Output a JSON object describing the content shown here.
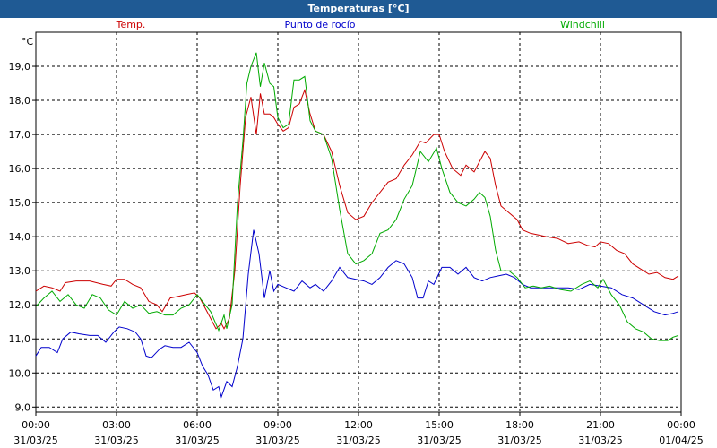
{
  "window": {
    "title": "Temperaturas [°C]"
  },
  "chart_data": {
    "type": "line",
    "title": "Temperaturas [°C]",
    "ylabel": "°C",
    "xlabel": "",
    "ylim": [
      8.85,
      20.0
    ],
    "xlim": [
      0,
      24
    ],
    "grid": true,
    "legend_placement": "top",
    "y_ticks": [
      "9,0",
      "10,0",
      "11,0",
      "12,0",
      "13,0",
      "14,0",
      "15,0",
      "16,0",
      "17,0",
      "18,0",
      "19,0"
    ],
    "y_tick_values": [
      9,
      10,
      11,
      12,
      13,
      14,
      15,
      16,
      17,
      18,
      19
    ],
    "x_ticks": [
      {
        "value": 0,
        "time": "00:00",
        "date": "31/03/25"
      },
      {
        "value": 3,
        "time": "03:00",
        "date": "31/03/25"
      },
      {
        "value": 6,
        "time": "06:00",
        "date": "31/03/25"
      },
      {
        "value": 9,
        "time": "09:00",
        "date": "31/03/25"
      },
      {
        "value": 12,
        "time": "12:00",
        "date": "31/03/25"
      },
      {
        "value": 15,
        "time": "15:00",
        "date": "31/03/25"
      },
      {
        "value": 18,
        "time": "18:00",
        "date": "31/03/25"
      },
      {
        "value": 21,
        "time": "21:00",
        "date": "31/03/25"
      },
      {
        "value": 24,
        "time": "00:00",
        "date": "01/04/25"
      }
    ],
    "series": [
      {
        "name": "Temp.",
        "color": "#cc0000",
        "points": [
          [
            0,
            12.4
          ],
          [
            0.3,
            12.55
          ],
          [
            0.6,
            12.5
          ],
          [
            0.9,
            12.4
          ],
          [
            1.1,
            12.65
          ],
          [
            1.5,
            12.7
          ],
          [
            2.0,
            12.7
          ],
          [
            2.5,
            12.6
          ],
          [
            2.8,
            12.55
          ],
          [
            3.0,
            12.75
          ],
          [
            3.3,
            12.75
          ],
          [
            3.6,
            12.6
          ],
          [
            3.9,
            12.5
          ],
          [
            4.2,
            12.1
          ],
          [
            4.5,
            12.0
          ],
          [
            4.7,
            11.8
          ],
          [
            5.0,
            12.2
          ],
          [
            5.3,
            12.25
          ],
          [
            5.6,
            12.3
          ],
          [
            5.9,
            12.35
          ],
          [
            6.1,
            12.2
          ],
          [
            6.3,
            11.9
          ],
          [
            6.5,
            11.6
          ],
          [
            6.7,
            11.3
          ],
          [
            6.9,
            11.45
          ],
          [
            7.0,
            11.3
          ],
          [
            7.2,
            11.6
          ],
          [
            7.4,
            13.0
          ],
          [
            7.6,
            15.5
          ],
          [
            7.8,
            17.5
          ],
          [
            8.0,
            18.1
          ],
          [
            8.2,
            17.0
          ],
          [
            8.35,
            18.2
          ],
          [
            8.5,
            17.6
          ],
          [
            8.7,
            17.6
          ],
          [
            8.85,
            17.5
          ],
          [
            9.0,
            17.3
          ],
          [
            9.2,
            17.1
          ],
          [
            9.4,
            17.2
          ],
          [
            9.6,
            17.8
          ],
          [
            9.8,
            17.9
          ],
          [
            10.0,
            18.3
          ],
          [
            10.2,
            17.6
          ],
          [
            10.4,
            17.1
          ],
          [
            10.7,
            17.0
          ],
          [
            11.0,
            16.5
          ],
          [
            11.3,
            15.5
          ],
          [
            11.6,
            14.7
          ],
          [
            11.9,
            14.5
          ],
          [
            12.2,
            14.6
          ],
          [
            12.5,
            15.0
          ],
          [
            12.8,
            15.3
          ],
          [
            13.1,
            15.6
          ],
          [
            13.4,
            15.7
          ],
          [
            13.7,
            16.1
          ],
          [
            14.0,
            16.4
          ],
          [
            14.3,
            16.8
          ],
          [
            14.5,
            16.75
          ],
          [
            14.8,
            17.0
          ],
          [
            15.0,
            17.0
          ],
          [
            15.2,
            16.5
          ],
          [
            15.5,
            16.0
          ],
          [
            15.8,
            15.8
          ],
          [
            16.0,
            16.1
          ],
          [
            16.3,
            15.9
          ],
          [
            16.5,
            16.2
          ],
          [
            16.7,
            16.5
          ],
          [
            16.9,
            16.3
          ],
          [
            17.1,
            15.5
          ],
          [
            17.3,
            14.9
          ],
          [
            17.6,
            14.7
          ],
          [
            17.9,
            14.5
          ],
          [
            18.1,
            14.2
          ],
          [
            18.4,
            14.1
          ],
          [
            18.7,
            14.05
          ],
          [
            19.0,
            14.0
          ],
          [
            19.4,
            13.95
          ],
          [
            19.8,
            13.8
          ],
          [
            20.2,
            13.85
          ],
          [
            20.5,
            13.75
          ],
          [
            20.8,
            13.7
          ],
          [
            21.0,
            13.85
          ],
          [
            21.3,
            13.8
          ],
          [
            21.6,
            13.6
          ],
          [
            21.9,
            13.5
          ],
          [
            22.2,
            13.2
          ],
          [
            22.5,
            13.05
          ],
          [
            22.8,
            12.9
          ],
          [
            23.1,
            12.95
          ],
          [
            23.4,
            12.8
          ],
          [
            23.7,
            12.75
          ],
          [
            23.9,
            12.85
          ]
        ]
      },
      {
        "name": "Punto de rocío",
        "color": "#0000cc",
        "points": [
          [
            0,
            10.5
          ],
          [
            0.2,
            10.75
          ],
          [
            0.5,
            10.75
          ],
          [
            0.8,
            10.6
          ],
          [
            1.0,
            11.0
          ],
          [
            1.3,
            11.2
          ],
          [
            1.6,
            11.15
          ],
          [
            2.0,
            11.1
          ],
          [
            2.3,
            11.1
          ],
          [
            2.6,
            10.9
          ],
          [
            2.9,
            11.2
          ],
          [
            3.1,
            11.35
          ],
          [
            3.4,
            11.3
          ],
          [
            3.7,
            11.2
          ],
          [
            3.9,
            11.0
          ],
          [
            4.1,
            10.5
          ],
          [
            4.3,
            10.45
          ],
          [
            4.6,
            10.7
          ],
          [
            4.8,
            10.8
          ],
          [
            5.1,
            10.75
          ],
          [
            5.4,
            10.75
          ],
          [
            5.7,
            10.9
          ],
          [
            6.0,
            10.6
          ],
          [
            6.2,
            10.2
          ],
          [
            6.4,
            9.95
          ],
          [
            6.6,
            9.5
          ],
          [
            6.8,
            9.6
          ],
          [
            6.9,
            9.3
          ],
          [
            7.1,
            9.75
          ],
          [
            7.3,
            9.6
          ],
          [
            7.5,
            10.2
          ],
          [
            7.7,
            11.0
          ],
          [
            7.9,
            12.9
          ],
          [
            8.1,
            14.2
          ],
          [
            8.3,
            13.5
          ],
          [
            8.5,
            12.2
          ],
          [
            8.7,
            13.0
          ],
          [
            8.85,
            12.4
          ],
          [
            9.0,
            12.6
          ],
          [
            9.3,
            12.5
          ],
          [
            9.6,
            12.4
          ],
          [
            9.9,
            12.7
          ],
          [
            10.2,
            12.5
          ],
          [
            10.4,
            12.6
          ],
          [
            10.7,
            12.4
          ],
          [
            11.0,
            12.7
          ],
          [
            11.3,
            13.1
          ],
          [
            11.6,
            12.8
          ],
          [
            11.9,
            12.75
          ],
          [
            12.2,
            12.7
          ],
          [
            12.5,
            12.6
          ],
          [
            12.8,
            12.8
          ],
          [
            13.1,
            13.1
          ],
          [
            13.4,
            13.3
          ],
          [
            13.7,
            13.2
          ],
          [
            14.0,
            12.8
          ],
          [
            14.2,
            12.2
          ],
          [
            14.4,
            12.2
          ],
          [
            14.6,
            12.7
          ],
          [
            14.8,
            12.6
          ],
          [
            15.1,
            13.1
          ],
          [
            15.4,
            13.1
          ],
          [
            15.7,
            12.9
          ],
          [
            16.0,
            13.1
          ],
          [
            16.3,
            12.8
          ],
          [
            16.6,
            12.7
          ],
          [
            16.9,
            12.8
          ],
          [
            17.2,
            12.85
          ],
          [
            17.5,
            12.9
          ],
          [
            17.8,
            12.8
          ],
          [
            18.1,
            12.6
          ],
          [
            18.4,
            12.5
          ],
          [
            18.7,
            12.5
          ],
          [
            19.0,
            12.5
          ],
          [
            19.4,
            12.5
          ],
          [
            19.8,
            12.5
          ],
          [
            20.2,
            12.45
          ],
          [
            20.6,
            12.6
          ],
          [
            21.0,
            12.55
          ],
          [
            21.4,
            12.5
          ],
          [
            21.8,
            12.3
          ],
          [
            22.2,
            12.2
          ],
          [
            22.6,
            12.0
          ],
          [
            23.0,
            11.8
          ],
          [
            23.4,
            11.7
          ],
          [
            23.7,
            11.75
          ],
          [
            23.9,
            11.8
          ]
        ]
      },
      {
        "name": "Windchill",
        "color": "#00aa00",
        "points": [
          [
            0,
            11.95
          ],
          [
            0.3,
            12.2
          ],
          [
            0.6,
            12.4
          ],
          [
            0.9,
            12.1
          ],
          [
            1.2,
            12.3
          ],
          [
            1.5,
            12.0
          ],
          [
            1.8,
            11.9
          ],
          [
            2.1,
            12.3
          ],
          [
            2.4,
            12.2
          ],
          [
            2.7,
            11.85
          ],
          [
            3.0,
            11.7
          ],
          [
            3.3,
            12.1
          ],
          [
            3.6,
            11.9
          ],
          [
            3.9,
            12.0
          ],
          [
            4.2,
            11.75
          ],
          [
            4.5,
            11.8
          ],
          [
            4.8,
            11.7
          ],
          [
            5.1,
            11.7
          ],
          [
            5.4,
            11.9
          ],
          [
            5.7,
            12.0
          ],
          [
            6.0,
            12.3
          ],
          [
            6.2,
            12.1
          ],
          [
            6.5,
            11.8
          ],
          [
            6.8,
            11.25
          ],
          [
            7.0,
            11.7
          ],
          [
            7.1,
            11.3
          ],
          [
            7.3,
            12.0
          ],
          [
            7.5,
            15.0
          ],
          [
            7.7,
            16.8
          ],
          [
            7.85,
            18.5
          ],
          [
            8.0,
            19.0
          ],
          [
            8.2,
            19.4
          ],
          [
            8.35,
            18.4
          ],
          [
            8.5,
            19.1
          ],
          [
            8.7,
            18.5
          ],
          [
            8.85,
            18.4
          ],
          [
            9.0,
            17.5
          ],
          [
            9.2,
            17.2
          ],
          [
            9.4,
            17.3
          ],
          [
            9.6,
            18.6
          ],
          [
            9.8,
            18.6
          ],
          [
            10.0,
            18.7
          ],
          [
            10.2,
            17.4
          ],
          [
            10.4,
            17.1
          ],
          [
            10.7,
            17.0
          ],
          [
            11.0,
            16.3
          ],
          [
            11.3,
            14.8
          ],
          [
            11.6,
            13.5
          ],
          [
            11.9,
            13.2
          ],
          [
            12.2,
            13.3
          ],
          [
            12.5,
            13.5
          ],
          [
            12.8,
            14.1
          ],
          [
            13.1,
            14.2
          ],
          [
            13.4,
            14.5
          ],
          [
            13.7,
            15.1
          ],
          [
            14.0,
            15.5
          ],
          [
            14.3,
            16.5
          ],
          [
            14.6,
            16.2
          ],
          [
            14.9,
            16.6
          ],
          [
            15.1,
            16.0
          ],
          [
            15.4,
            15.3
          ],
          [
            15.7,
            15.0
          ],
          [
            16.0,
            14.9
          ],
          [
            16.3,
            15.1
          ],
          [
            16.5,
            15.3
          ],
          [
            16.7,
            15.15
          ],
          [
            16.9,
            14.6
          ],
          [
            17.1,
            13.6
          ],
          [
            17.3,
            13.0
          ],
          [
            17.6,
            13.0
          ],
          [
            17.9,
            12.8
          ],
          [
            18.2,
            12.5
          ],
          [
            18.5,
            12.55
          ],
          [
            18.8,
            12.5
          ],
          [
            19.1,
            12.55
          ],
          [
            19.5,
            12.45
          ],
          [
            19.9,
            12.4
          ],
          [
            20.3,
            12.6
          ],
          [
            20.6,
            12.7
          ],
          [
            20.9,
            12.5
          ],
          [
            21.1,
            12.75
          ],
          [
            21.4,
            12.3
          ],
          [
            21.7,
            12.0
          ],
          [
            22.0,
            11.5
          ],
          [
            22.3,
            11.3
          ],
          [
            22.6,
            11.2
          ],
          [
            22.9,
            11.0
          ],
          [
            23.2,
            10.95
          ],
          [
            23.5,
            10.95
          ],
          [
            23.7,
            11.05
          ],
          [
            23.9,
            11.1
          ]
        ]
      }
    ]
  }
}
